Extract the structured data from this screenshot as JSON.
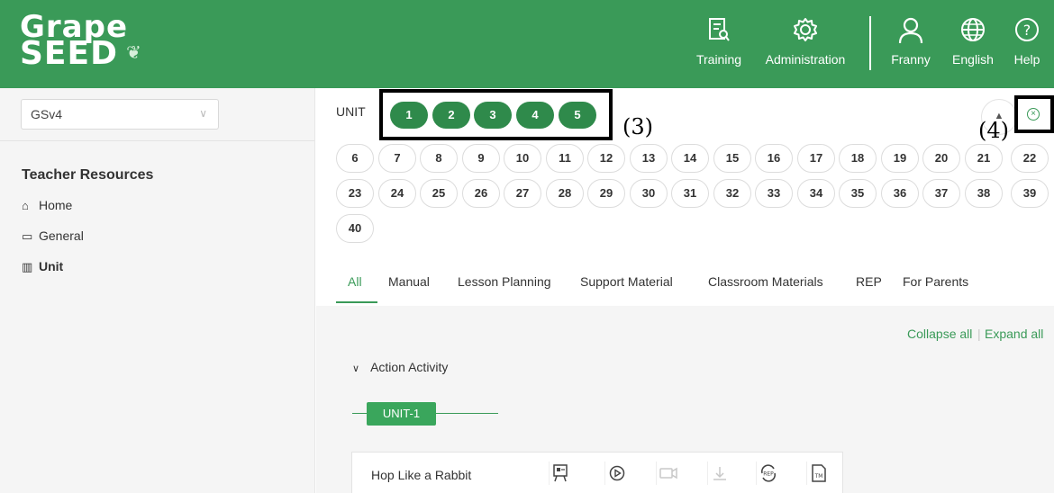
{
  "header": {
    "logo_line1": "Grape",
    "logo_line2": "SEED",
    "nav": [
      {
        "label": "Training",
        "icon": "training-icon"
      },
      {
        "label": "Administration",
        "icon": "gear-icon"
      },
      {
        "label": "Franny",
        "icon": "user-icon"
      },
      {
        "label": "English",
        "icon": "globe-icon"
      },
      {
        "label": "Help",
        "icon": "help-icon"
      }
    ]
  },
  "sidebar": {
    "select_value": "GSv4",
    "title": "Teacher Resources",
    "items": [
      {
        "label": "Home",
        "icon": "home-icon"
      },
      {
        "label": "General",
        "icon": "general-icon"
      },
      {
        "label": "Unit",
        "icon": "unit-icon"
      }
    ]
  },
  "units": {
    "label": "UNIT",
    "highlighted": [
      "1",
      "2",
      "3",
      "4",
      "5"
    ],
    "row1": [
      "6",
      "7",
      "8",
      "9",
      "10",
      "11",
      "12",
      "13",
      "14",
      "15",
      "16",
      "17",
      "18",
      "19",
      "20",
      "21",
      "22"
    ],
    "row2": [
      "23",
      "24",
      "25",
      "26",
      "27",
      "28",
      "29",
      "30",
      "31",
      "32",
      "33",
      "34",
      "35",
      "36",
      "37",
      "38",
      "39"
    ],
    "row3": [
      "40"
    ]
  },
  "annotations": {
    "a3": "(3)",
    "a4": "(4)"
  },
  "tabs": [
    "All",
    "Manual",
    "Lesson Planning",
    "Support Material",
    "Classroom Materials",
    "REP",
    "For Parents"
  ],
  "content": {
    "collapse_all": "Collapse all",
    "separator": "|",
    "expand_all": "Expand all",
    "section": "Action Activity",
    "unit_tag": "UNIT-1",
    "activity": "Hop Like a Rabbit"
  },
  "colors": {
    "brand_green": "#3a9a58",
    "chip_green": "#2f8a4b"
  }
}
